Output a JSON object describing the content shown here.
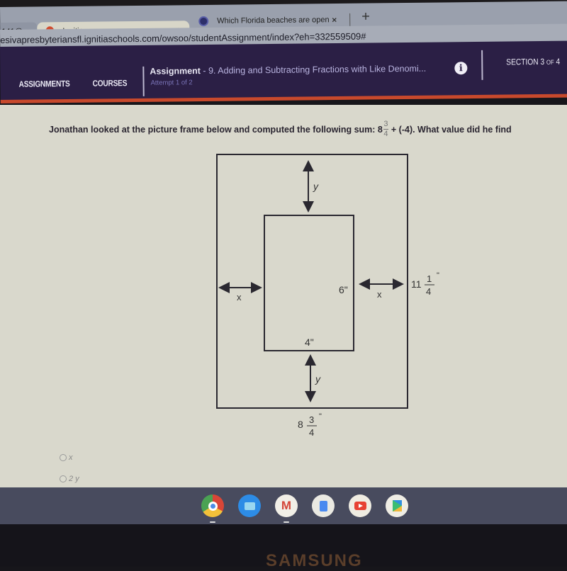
{
  "browser": {
    "tabs": [
      {
        "label": "141@",
        "favicon": "none",
        "active": false
      },
      {
        "label": "Ignitia",
        "favicon": "ignitia-flame-icon",
        "active": true
      },
      {
        "label": "Which Florida beaches are open",
        "favicon": "globe-icon",
        "active": false
      }
    ],
    "close_glyph": "×",
    "new_tab_glyph": "+",
    "url": "esivapresbyteriansfl.ignitiaschools.com/owsoo/studentAssignment/index?eh=332559509#"
  },
  "nav": {
    "links": [
      "ASSIGNMENTS",
      "COURSES"
    ],
    "assignment_label": "Assignment",
    "assignment_title": " - 9. Adding and Subtracting Fractions with Like Denomi...",
    "attempt": "Attempt 1 of 2",
    "info_glyph": "i",
    "section_prefix": "SECTION 3 ",
    "section_of": "OF",
    "section_total": " 4",
    "colors": {
      "navbar": "#2b1f45",
      "accent_stripe": "#c8492c"
    }
  },
  "question": {
    "text_before": "Jonathan looked at the picture frame below and computed the following sum: 8",
    "frac_num": "3",
    "frac_den": "4",
    "text_after": "+ (-4). What value did he find"
  },
  "diagram": {
    "top_gap_label": "y",
    "bottom_gap_label": "y",
    "left_gap_label": "x",
    "right_gap_label": "x",
    "inner_height_label": "6\"",
    "inner_width_label": "4\"",
    "outer_height_whole": "11",
    "outer_height_num": "1",
    "outer_height_den": "4",
    "outer_width_whole": "8",
    "outer_width_num": "3",
    "outer_width_den": "4",
    "inch_mark": "\""
  },
  "choices": [
    {
      "label": "x"
    },
    {
      "label": "2 y"
    }
  ],
  "shelf": {
    "apps": [
      "chrome-icon",
      "files-icon",
      "gmail-icon",
      "docs-icon",
      "youtube-icon",
      "play-store-icon"
    ],
    "gmail_glyph": "M"
  },
  "device": {
    "brand": "SAMSUNG"
  }
}
